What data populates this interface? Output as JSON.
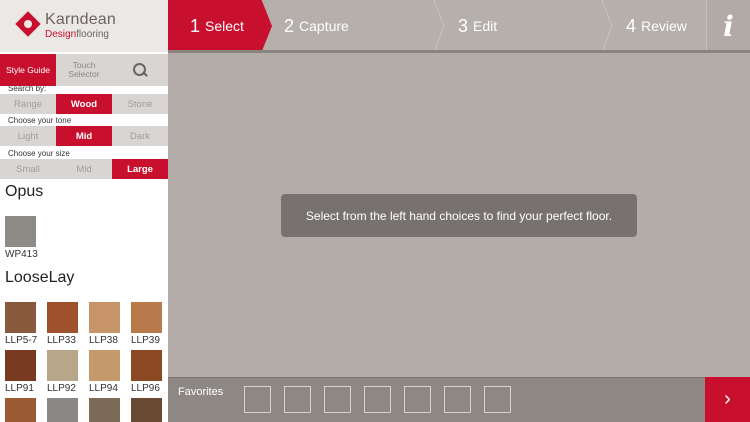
{
  "header": {
    "brand": "Karndean",
    "sub_design": "Design",
    "sub_flooring": "flooring",
    "steps": [
      {
        "num": "1",
        "label": "Select"
      },
      {
        "num": "2",
        "label": "Capture"
      },
      {
        "num": "3",
        "label": "Edit"
      },
      {
        "num": "4",
        "label": "Review"
      }
    ],
    "info": "i"
  },
  "sidebar": {
    "modes": {
      "style_guide": "Style Guide",
      "touch_selector": "Touch Selector"
    },
    "search_by": {
      "label": "Search by:",
      "options": [
        "Range",
        "Wood",
        "Stone"
      ],
      "selected": "Wood"
    },
    "tone": {
      "label": "Choose your tone",
      "options": [
        "Light",
        "Mid",
        "Dark"
      ],
      "selected": "Mid"
    },
    "size": {
      "label": "Choose your size",
      "options": [
        "Small",
        "Mid",
        "Large"
      ],
      "selected": "Large"
    },
    "collections": [
      {
        "name": "Opus",
        "items": [
          {
            "code": "WP413",
            "color": "#8e8a86"
          }
        ]
      },
      {
        "name": "LooseLay",
        "items": [
          {
            "code": "LLP5-7",
            "color": "#8a5a3e"
          },
          {
            "code": "LLP33",
            "color": "#a0522d"
          },
          {
            "code": "LLP38",
            "color": "#c8956a"
          },
          {
            "code": "LLP39",
            "color": "#b87a4b"
          },
          {
            "code": "LLP91",
            "color": "#7a3a22"
          },
          {
            "code": "LLP92",
            "color": "#b8a68a"
          },
          {
            "code": "LLP94",
            "color": "#c49a6c"
          },
          {
            "code": "LLP96",
            "color": "#8c4a24"
          },
          {
            "code": "",
            "color": "#9a5a34"
          },
          {
            "code": "",
            "color": "#8a8884"
          },
          {
            "code": "",
            "color": "#7a6a56"
          },
          {
            "code": "",
            "color": "#6a4a32"
          }
        ]
      }
    ]
  },
  "main": {
    "hint": "Select from the left hand choices to find your perfect floor."
  },
  "favorites": {
    "label": "Favorites",
    "slots": 7
  },
  "next": "›",
  "colors": {
    "accent": "#c8102e",
    "panel": "#b4aca8"
  }
}
